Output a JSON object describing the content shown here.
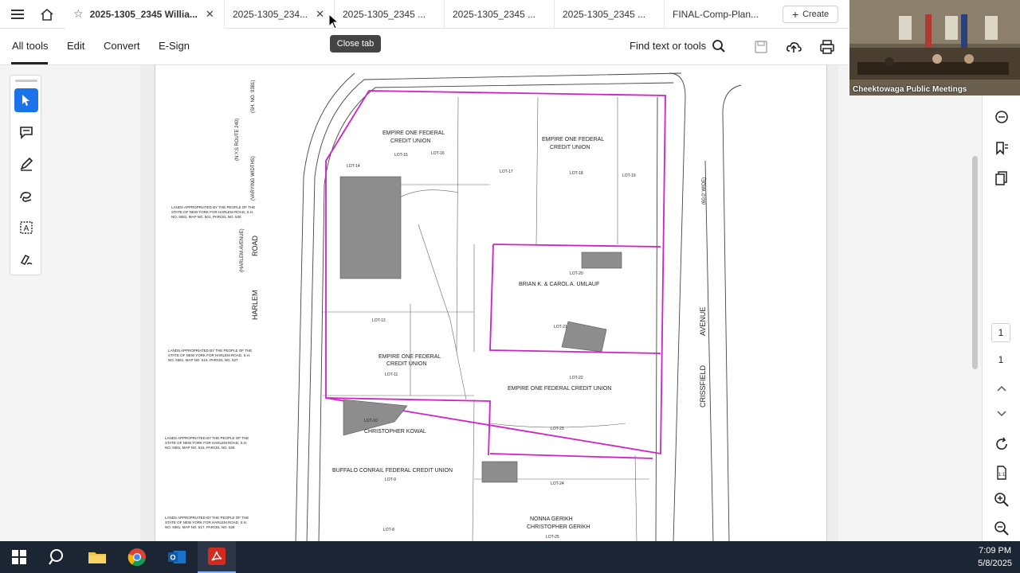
{
  "tabs": [
    {
      "label": "2025-1305_2345 Willia...",
      "active": true
    },
    {
      "label": "2025-1305_234..."
    },
    {
      "label": "2025-1305_2345 ..."
    },
    {
      "label": "2025-1305_2345 ..."
    },
    {
      "label": "2025-1305_2345 ..."
    },
    {
      "label": "FINAL-Comp-Plan..."
    }
  ],
  "create_label": "Create",
  "tooltip": "Close tab",
  "toolbar": {
    "all_tools": "All tools",
    "edit": "Edit",
    "convert": "Convert",
    "esign": "E-Sign",
    "find": "Find text or tools"
  },
  "webcam": {
    "label": "Cheektowaga Public Meetings"
  },
  "page_nav": {
    "current": "1",
    "total": "1"
  },
  "clock": {
    "time": "7:09 PM",
    "date": "5/8/2025"
  },
  "drawing": {
    "roads": {
      "harlem": "HARLEM",
      "road": "ROAD",
      "harlem_avenue": "(HARLEM AVENUE)",
      "nys_route": "(N.Y.S ROUTE 240)",
      "sh_no": "(SH. NO. 9381)",
      "varying_width": "(VARYING WIDTHS)",
      "crissfield": "CRISSFIELD",
      "avenue": "AVENUE",
      "sixty_wide": "(60.0' WIDE)"
    },
    "owners": [
      {
        "name": "EMPIRE ONE FEDERAL",
        "line2": "CREDIT UNION",
        "lot": "LOT-15"
      },
      {
        "name": "EMPIRE ONE FEDERAL",
        "line2": "CREDIT UNION",
        "lot": "LOT-18"
      },
      {
        "name": "BRIAN K. & CAROL A. UMLAUF",
        "lot": "LOT-20"
      },
      {
        "name": "EMPIRE ONE FEDERAL",
        "line2": "CREDIT UNION",
        "lot": "LOT-11"
      },
      {
        "name": "EMPIRE ONE FEDERAL CREDIT UNION",
        "lot": "LOT-22"
      },
      {
        "name": "CHRISTOPHER KOWAL",
        "lot": "LOT-10"
      },
      {
        "name": "BUFFALO CONRAIL FEDERAL CREDIT UNION",
        "lot": "LOT-9"
      },
      {
        "name": "NONNA GERIKH",
        "line2": "CHRISTOPHER GERIKH",
        "lot": "LOT-25"
      }
    ],
    "lots": [
      "LOT-14",
      "LOT-16",
      "LOT-17",
      "LOT-19",
      "LOT-12",
      "LOT-21",
      "LOT-23",
      "LOT-24",
      "LOT-8"
    ],
    "lands_appropriated": "LANDS APPROPRIATED BY THE PEOPLE OF THE",
    "state_of_ny": "STATE OF NEW YORK FOR HARLEM ROAD, S.H.",
    "map_parcel_1": "NO. 9381, MAP NO. 501, PARCEL NO. 530",
    "map_parcel_2": "NO. 9381, MAP NO. 516, PARCEL NO. 527",
    "map_parcel_3": "NO. 9381, MAP NO. 516, PARCEL NO. 525",
    "map_parcel_4": "NO. 9381, MAP NO. 517, PARCEL NO. 528"
  }
}
